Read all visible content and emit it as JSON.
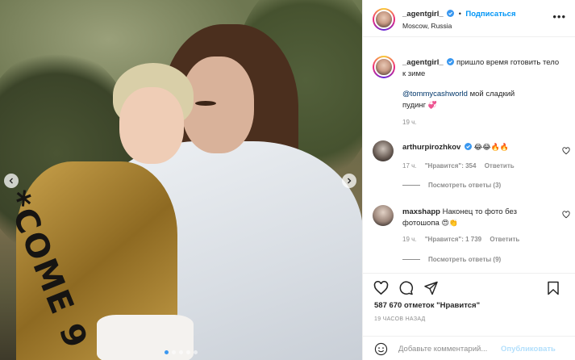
{
  "post": {
    "username": "_agentgirl_",
    "follow_separator": "•",
    "follow_label": "Подписаться",
    "location": "Moscow, Russia",
    "more_icon": "more-dots-icon",
    "caption": "пришло время готовить тело к зиме",
    "mention": "@tommycashworld",
    "mention_text": "мой сладкий пудинг",
    "mention_emoji": "💞",
    "caption_time": "19 ч.",
    "photo": {
      "jacket_text": "*COME 9",
      "slide_count": 5,
      "active_slide": 0
    }
  },
  "comments": [
    {
      "username": "arthurpirozhkov",
      "verified": true,
      "text": "",
      "emoji": "😂😂🔥🔥",
      "time": "17 ч.",
      "likes": "\"Нравится\": 354",
      "reply": "Ответить",
      "view_replies": "Посмотреть ответы (3)"
    },
    {
      "username": "maxshapp",
      "verified": false,
      "text": "Наконец то фото без фотошопа",
      "emoji": "😍👏",
      "time": "19 ч.",
      "likes": "\"Нравится\": 1 739",
      "reply": "Ответить",
      "view_replies": "Посмотреть ответы (9)"
    }
  ],
  "stats": {
    "likes": "587 670 отметок \"Нравится\"",
    "ago": "19 ЧАСОВ НАЗАД"
  },
  "composer": {
    "placeholder": "Добавьте комментарий...",
    "publish": "Опубликовать"
  },
  "colors": {
    "accent": "#0095f6",
    "verified": "#3897f0",
    "muted": "#8e8e8e",
    "publish_disabled": "#b2dffc"
  }
}
